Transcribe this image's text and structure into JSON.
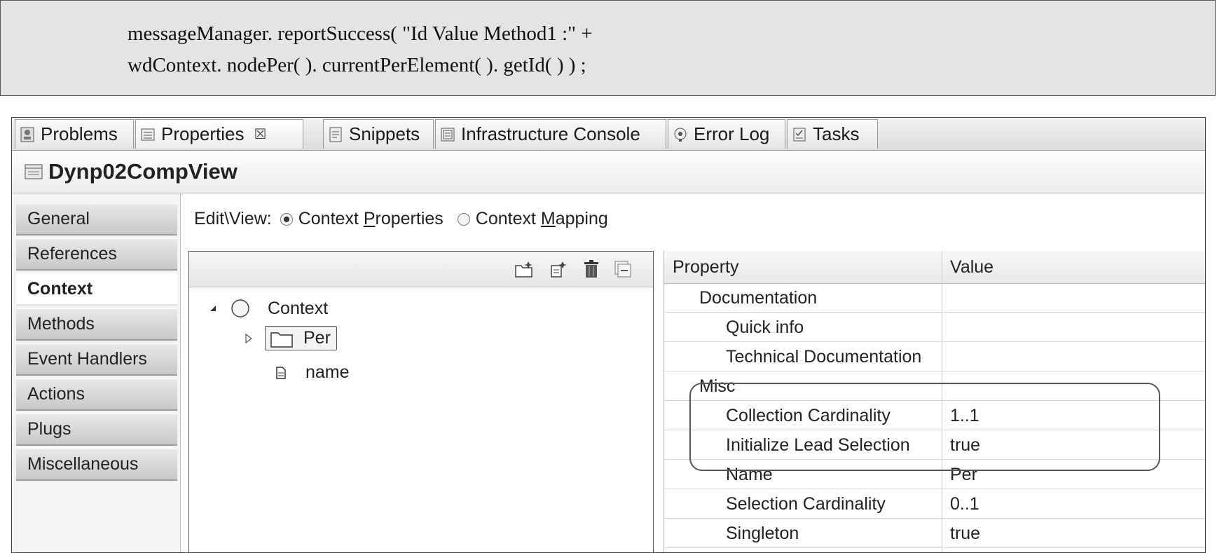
{
  "code": {
    "line1": "messageManager. reportSuccess( \"Id Value Method1 :\" +",
    "line2": "wdContext. nodePer( ). currentPerElement( ). getId( ) ) ;"
  },
  "tabs": [
    {
      "label": "Problems",
      "icon": "problems-icon"
    },
    {
      "label": "Properties",
      "icon": "properties-icon",
      "close": "☒"
    },
    {
      "label": "Snippets",
      "icon": "snippets-icon"
    },
    {
      "label": "Infrastructure Console",
      "icon": "console-icon"
    },
    {
      "label": "Error Log",
      "icon": "error-log-icon"
    },
    {
      "label": "Tasks",
      "icon": "tasks-icon"
    }
  ],
  "view_title": "Dynp02CompView",
  "nav": {
    "items": [
      "General",
      "References",
      "Context",
      "Methods",
      "Event Handlers",
      "Actions",
      "Plugs",
      "Miscellaneous"
    ],
    "selected": "Context"
  },
  "editview": {
    "label": "Edit\\View:",
    "option1_pre": "Context ",
    "option1_u": "P",
    "option1_post": "roperties",
    "option2_pre": "Context ",
    "option2_u": "M",
    "option2_post": "apping",
    "selected": "Context Properties"
  },
  "tree": {
    "root": "Context",
    "node": "Per",
    "attribute": "name"
  },
  "properties": {
    "col_property": "Property",
    "col_value": "Value",
    "rows": [
      {
        "name": "Documentation",
        "value": "",
        "level": 1
      },
      {
        "name": "Quick info",
        "value": "",
        "level": 2
      },
      {
        "name": "Technical Documentation",
        "value": "",
        "level": 2
      },
      {
        "name": "Misc",
        "value": "",
        "level": 1
      },
      {
        "name": "Collection Cardinality",
        "value": "1..1",
        "level": 2
      },
      {
        "name": "Initialize Lead Selection",
        "value": "true",
        "level": 2
      },
      {
        "name": "Name",
        "value": "Per",
        "level": 2
      },
      {
        "name": "Selection Cardinality",
        "value": "0..1",
        "level": 2
      },
      {
        "name": "Singleton",
        "value": "true",
        "level": 2
      }
    ]
  }
}
